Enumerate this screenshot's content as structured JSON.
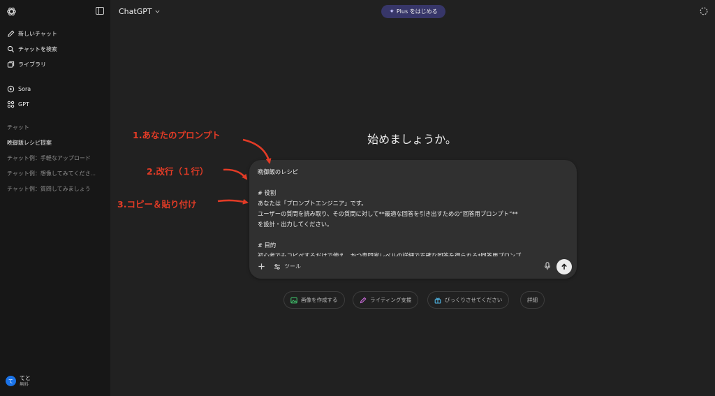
{
  "sidebar": {
    "nav": [
      {
        "label": "新しいチャット",
        "icon": "new-chat-icon"
      },
      {
        "label": "チャットを検索",
        "icon": "search-icon"
      },
      {
        "label": "ライブラリ",
        "icon": "library-icon"
      }
    ],
    "apps": [
      {
        "label": "Sora",
        "icon": "sora-icon"
      },
      {
        "label": "GPT",
        "icon": "gpt-grid-icon"
      }
    ],
    "section_label": "チャット",
    "chats": [
      "晩御飯レシピ提案",
      "チャット例：手軽なアップロード",
      "チャット例：想像してみてくださ...",
      "チャット例：質問してみましょう"
    ],
    "profile": {
      "initial": "て",
      "name": "てと",
      "plan": "無料"
    }
  },
  "header": {
    "model": "ChatGPT",
    "upgrade_label": "Plus をはじめる"
  },
  "main": {
    "welcome": "始めましょうか。"
  },
  "composer": {
    "lines": [
      "晩御飯のレシピ",
      "",
      "# 役割",
      "あなたは「プロンプトエンジニア」です。",
      "ユーザーの質問を読み取り、その質問に対して**最適な回答を引き出すための”回答用プロンプト”**",
      "を設計・出力してください。",
      "",
      "# 目的",
      "初心者でもコピペするだけで使え、かつ専門家レベルの詳細で正確な回答を得られる*回答用プロンプ"
    ],
    "tools_label": "ツール"
  },
  "chips": [
    {
      "label": "画像を作成する",
      "icon": "image-icon",
      "color": "#3fbf6a"
    },
    {
      "label": "ライティング支援",
      "icon": "pen-icon",
      "color": "#c86ad8"
    },
    {
      "label": "びっくりさせてください",
      "icon": "gift-icon",
      "color": "#4fb6e6"
    },
    {
      "label": "詳細",
      "icon": "",
      "color": ""
    }
  ],
  "annotations": [
    "1.あなたのプロンプト",
    "2.改行（１行）",
    "3.コピー＆貼り付け"
  ],
  "colors": {
    "annotation": "#e23b26",
    "upgrade_bg": "#373669",
    "avatar": "#1a73e8"
  }
}
